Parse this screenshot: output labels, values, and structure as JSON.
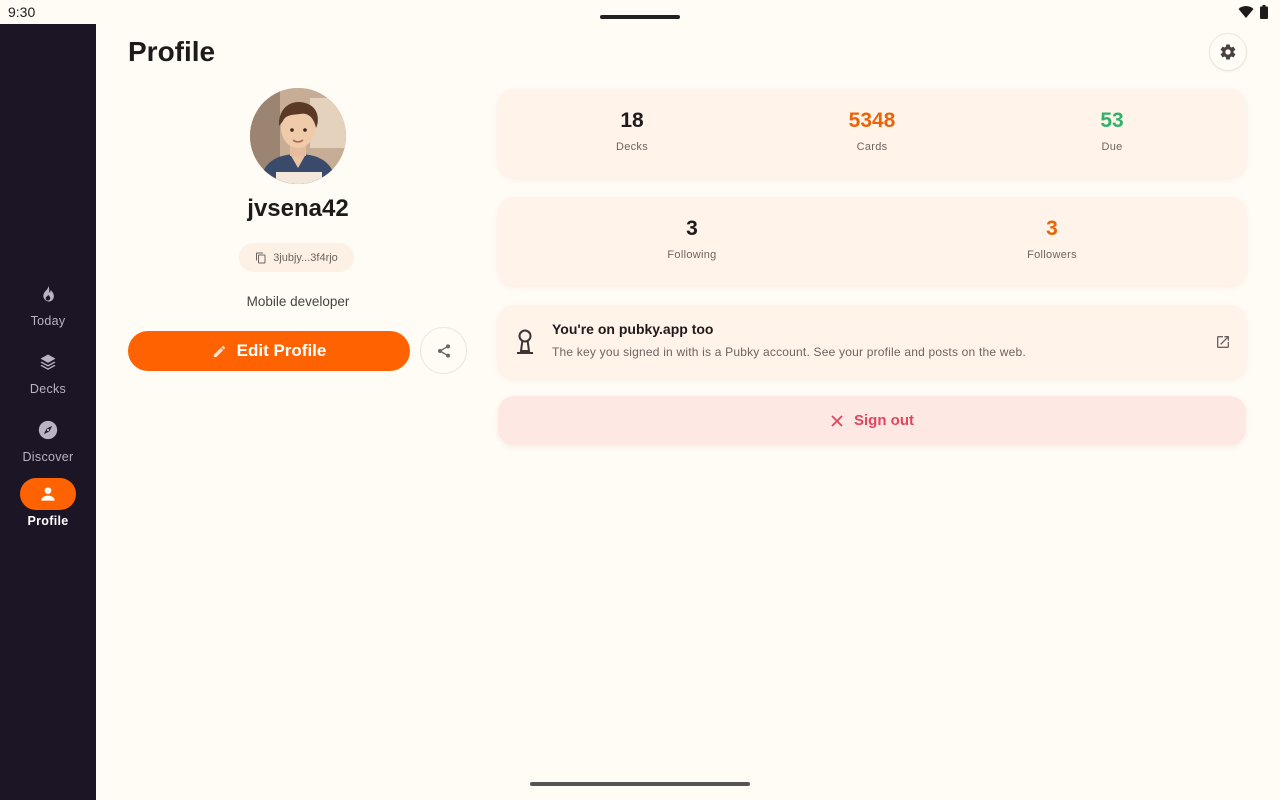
{
  "status_bar": {
    "time": "9:30"
  },
  "nav": {
    "items": [
      {
        "label": "Today",
        "icon": "flame-icon",
        "active": false
      },
      {
        "label": "Decks",
        "icon": "layers-icon",
        "active": false
      },
      {
        "label": "Discover",
        "icon": "compass-icon",
        "active": false
      },
      {
        "label": "Profile",
        "icon": "person-icon",
        "active": true
      }
    ]
  },
  "header": {
    "title": "Profile",
    "settings_icon": "gear-icon"
  },
  "profile": {
    "username": "jvsena42",
    "key": "3jubjy...3f4rjo",
    "bio": "Mobile developer",
    "edit_label": "Edit Profile",
    "share_icon": "share-icon"
  },
  "stats": [
    {
      "value": "18",
      "caption": "Decks",
      "color": "#1f1b1a"
    },
    {
      "value": "5348",
      "caption": "Cards",
      "color": "#e8650a"
    },
    {
      "value": "53",
      "caption": "Due",
      "color": "#2fb36b"
    }
  ],
  "social": [
    {
      "value": "3",
      "caption": "Following",
      "color": "#1f1b1a"
    },
    {
      "value": "3",
      "caption": "Followers",
      "color": "#e8650a"
    }
  ],
  "pubky": {
    "title": "You're on pubky.app too",
    "description": "The key you signed in with is a Pubky account. See your profile and posts on the web."
  },
  "sign_out": {
    "label": "Sign out"
  },
  "colors": {
    "accent": "#ff6200",
    "rail_bg": "#1c1526",
    "danger": "#e2455e"
  }
}
